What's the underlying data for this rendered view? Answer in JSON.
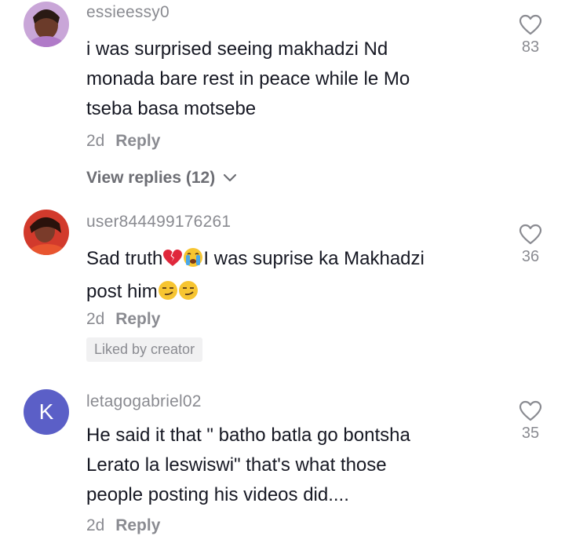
{
  "comments": [
    {
      "username": "essieessy0",
      "text_lines": [
        "i was surprised seeing makhadzi Nd",
        "monada bare rest in peace while le Mo",
        "tseba basa motsebe"
      ],
      "time": "2d",
      "reply_label": "Reply",
      "likes": "83",
      "view_replies": "View replies (12)"
    },
    {
      "username": "user844499176261",
      "text_line1_a": "Sad truth",
      "text_line1_b": "I was suprise ka Makhadzi",
      "text_line2": "post him",
      "time": "2d",
      "reply_label": "Reply",
      "likes": "36",
      "badge": "Liked by creator"
    },
    {
      "username": "letagogabriel02",
      "avatar_letter": "K",
      "text_lines": [
        "He said it that \" batho batla go bontsha",
        "Lerato la leswiswi\" that's what those",
        "people posting his videos did...."
      ],
      "time": "2d",
      "reply_label": "Reply",
      "likes": "35"
    }
  ],
  "colors": {
    "primary_text": "#161823",
    "secondary_text": "#8a8b91",
    "avatar_k_bg": "#5b5fc7"
  },
  "icons": [
    "heart-outline-icon",
    "chevron-down-icon",
    "broken-heart-emoji",
    "crying-face-emoji",
    "smirking-face-emoji"
  ]
}
